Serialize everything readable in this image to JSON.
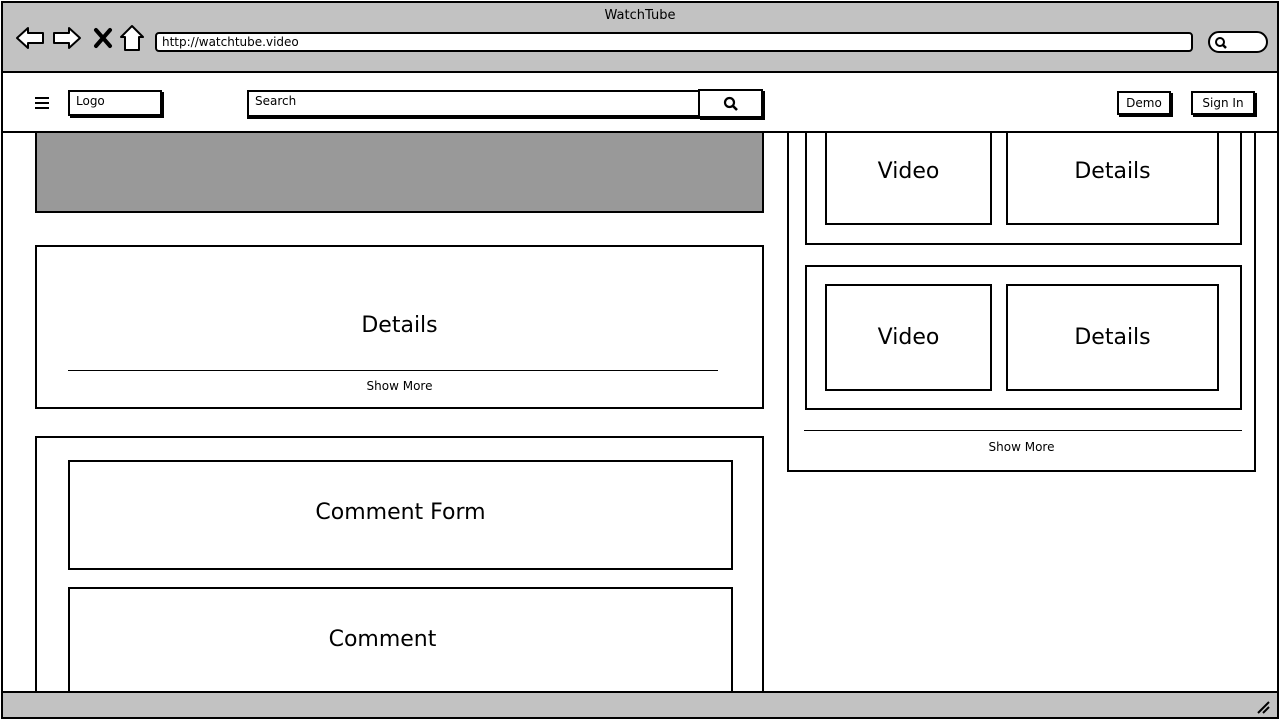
{
  "browser": {
    "window_title": "WatchTube",
    "url": "http://watchtube.video",
    "icons": [
      "back-arrow-icon",
      "forward-arrow-icon",
      "close-icon",
      "home-icon",
      "search-icon",
      "resize-grip-icon"
    ]
  },
  "header": {
    "logo": "Logo",
    "search_placeholder": "Search",
    "demo_label": "Demo",
    "signin_label": "Sign In",
    "icons": [
      "hamburger-menu-icon",
      "search-icon"
    ]
  },
  "main": {
    "details": {
      "title": "Details",
      "show_more": "Show More"
    },
    "comments": {
      "form_label": "Comment Form",
      "comment_label": "Comment"
    }
  },
  "sidebar": {
    "cards": [
      {
        "video": "Video",
        "details": "Details"
      },
      {
        "video": "Video",
        "details": "Details"
      }
    ],
    "show_more": "Show More"
  }
}
